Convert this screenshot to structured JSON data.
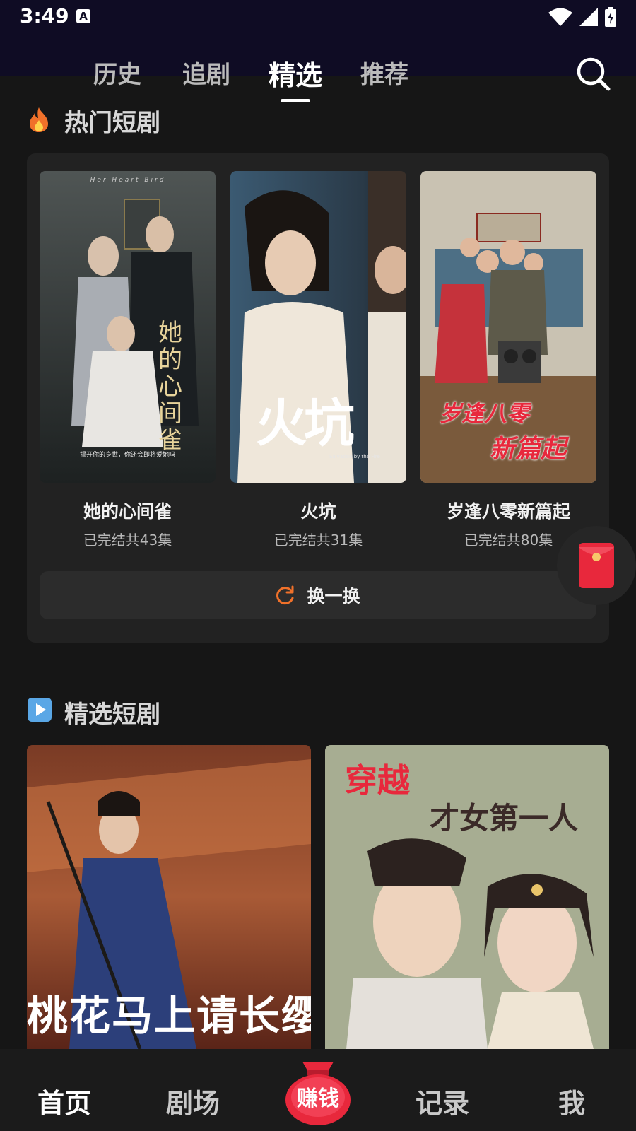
{
  "status_bar": {
    "time": "3:49",
    "notification_letter": "A"
  },
  "top_tabs": [
    {
      "label": "历史",
      "active": false
    },
    {
      "label": "追剧",
      "active": false
    },
    {
      "label": "精选",
      "active": true
    },
    {
      "label": "推荐",
      "active": false
    }
  ],
  "hot_section": {
    "title": "热门短剧",
    "icon": "fire-icon",
    "dramas": [
      {
        "title": "她的心间雀",
        "status": "已完结共43集",
        "poster_text": "她的心间雀",
        "poster_tag": "Her Heart Bird",
        "poster_caption": "揭开你的身世，你还会即将爱她吗"
      },
      {
        "title": "火坑",
        "status": "已完结共31集",
        "poster_text": "火坑",
        "poster_tag": "Salvation by the Fire"
      },
      {
        "title": "岁逢八零新篇起",
        "status": "已完结共80集",
        "poster_text_line1": "岁逢八零",
        "poster_text_line2": "新篇起"
      }
    ],
    "refresh_label": "换一换"
  },
  "featured_section": {
    "title": "精选短剧",
    "icon": "play-icon",
    "posters": [
      {
        "poster_text": "桃花马上请长缨"
      },
      {
        "poster_text_line1": "穿越",
        "poster_text_line2": "才女第一人"
      }
    ]
  },
  "bottom_nav": [
    {
      "label": "首页",
      "active": true
    },
    {
      "label": "剧场",
      "active": false
    },
    {
      "label": "赚钱",
      "active": false
    },
    {
      "label": "记录",
      "active": false
    },
    {
      "label": "我",
      "active": false
    }
  ],
  "colors": {
    "background": "#161616",
    "panel": "#222222",
    "accent_orange": "#f0712a",
    "red": "#e8283c"
  }
}
